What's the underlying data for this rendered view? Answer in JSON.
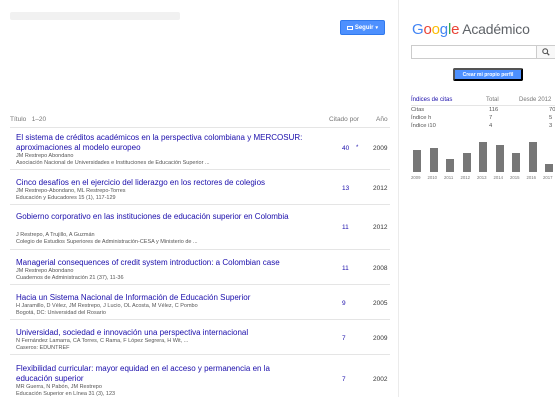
{
  "header": {
    "follow_label": "Seguir"
  },
  "table": {
    "col_title": "Título",
    "col_range": "1–20",
    "col_cited": "Citado por",
    "col_year": "Año",
    "rows": [
      {
        "title": "El sistema de créditos académicos en la perspectiva colombiana y MERCOSUR: aproximaciones al modelo europeo",
        "authors": "JM Restrepo Abondano",
        "source": "Asociación Nacional de Universidades e Instituciones de Educación Superior ...",
        "cited": "40",
        "star": "*",
        "year": "2009"
      },
      {
        "title": "Cinco desafíos en el ejercicio del liderazgo en los rectores de colegios",
        "authors": "JM Restrepo-Abondano, ML Restrepo-Torres",
        "source": "Educación y Educadores 15 (1), 117-129",
        "cited": "13",
        "star": "",
        "year": "2012"
      },
      {
        "title": "Gobierno corporativo en las instituciones de educación superior en Colombia",
        "authors": "J Restrepo, A Trujillo, A Guzmán",
        "source": "Colegio de Estudios Superiores de Administración-CESA y Ministerio de ...",
        "cited": "11",
        "star": "",
        "year": "2012"
      },
      {
        "title": "Managerial consequences of credit system introduction: a Colombian case",
        "authors": "JM Restrepo Abondano",
        "source": "Cuadernos de Administración 21 (37), 11-36",
        "cited": "11",
        "star": "",
        "year": "2008"
      },
      {
        "title": "Hacia un Sistema Nacional de Información de Educación Superior",
        "authors": "H Jaramillo, D Vélez, JM Restrepo, J Lucio, OL Acosta, M Vélez, C Pombo",
        "source": "Bogotá, DC: Universidad del Rosario",
        "cited": "9",
        "star": "",
        "year": "2005"
      },
      {
        "title": "Universidad, sociedad e innovación una perspectiva internacional",
        "authors": "N Fernández Lamarra, CA Torres, C Rama, F López Segrera, H Wit, ...",
        "source": "Caseros: EDUNTREF",
        "cited": "7",
        "star": "",
        "year": "2009"
      },
      {
        "title": "Flexibilidad curricular: mayor equidad en el acceso y permanencia en la educación superior",
        "authors": "MR Guerra, N Pabón, JM Restrepo",
        "source": "Educación Superior en Línea 31 (3), 123",
        "cited": "7",
        "star": "",
        "year": "2002"
      }
    ]
  },
  "sidebar": {
    "logo_google": [
      "G",
      "o",
      "o",
      "g",
      "l",
      "e"
    ],
    "logo_rest": "Académico",
    "create_profile": "Crear mi propio perfil",
    "indices": {
      "heading": "Índices de citas",
      "col_total": "Total",
      "col_since": "Desde 2012",
      "rows": [
        {
          "label": "Citas",
          "total": "116",
          "since": "70"
        },
        {
          "label": "Índice h",
          "total": "7",
          "since": "5"
        },
        {
          "label": "Índice i10",
          "total": "4",
          "since": "3"
        }
      ]
    },
    "histogram": {
      "years": [
        "2009",
        "2010",
        "2011",
        "2012",
        "2013",
        "2014",
        "2015",
        "2016",
        "2017"
      ],
      "values": [
        14,
        15,
        8,
        12,
        19,
        17,
        12,
        19,
        5
      ]
    }
  },
  "colors": {
    "accent": "#4d90fe",
    "link": "#1a0dab"
  }
}
